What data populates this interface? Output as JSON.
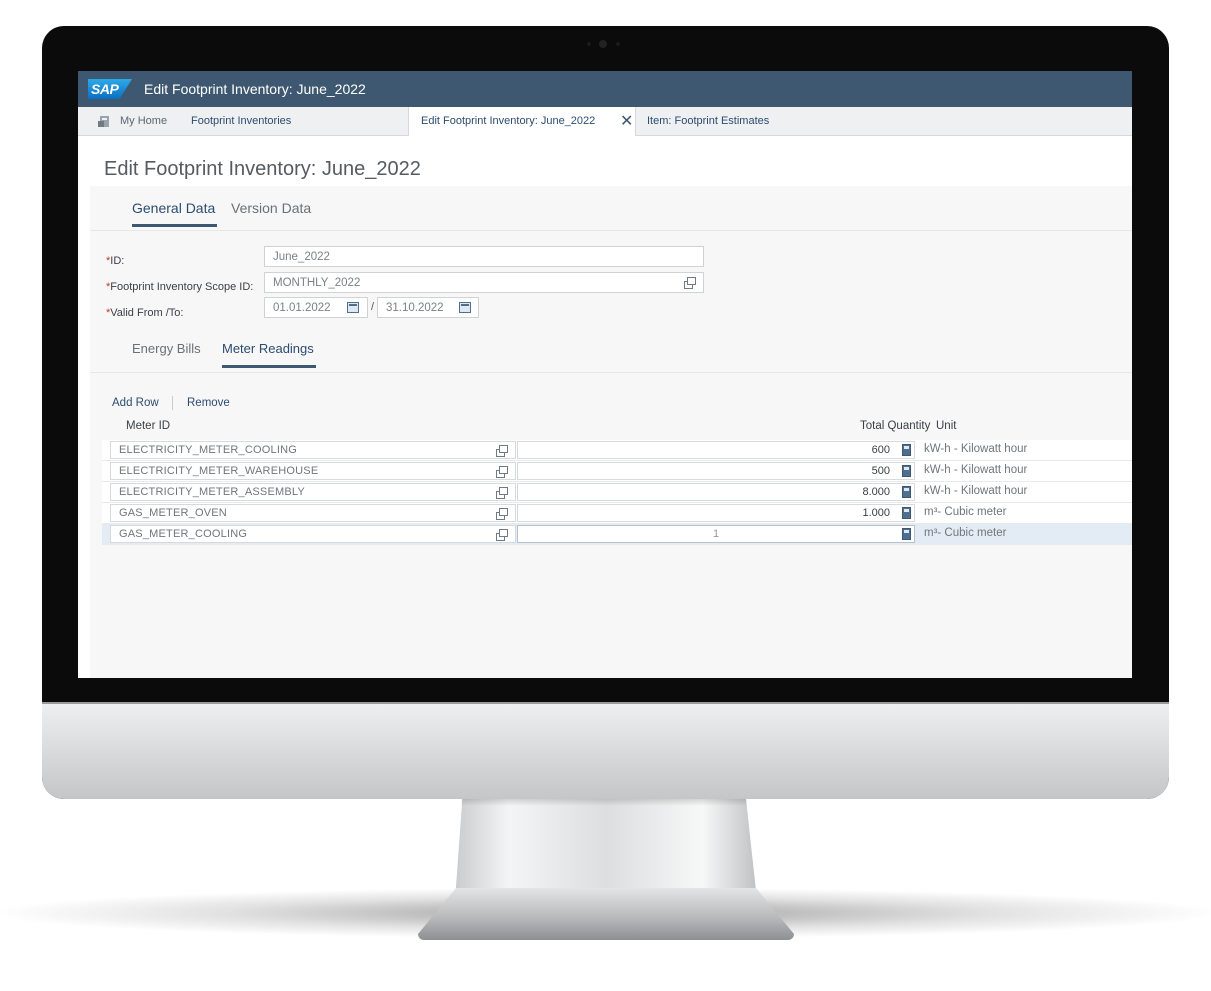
{
  "shell": {
    "logo": "SAP",
    "title": "Edit Footprint Inventory: June_2022"
  },
  "tabs": {
    "home": "My Home",
    "crumb": "Footprint Inventories",
    "active": "Edit Footprint Inventory: June_2022",
    "item": "Item: Footprint Estimates"
  },
  "page": {
    "title": "Edit Footprint Inventory: June_2022",
    "object_tabs": [
      "General Data",
      "Version Data"
    ],
    "active_object_tab": "General Data"
  },
  "form": {
    "required_mark": "*",
    "id_label": "ID:",
    "id_value": "June_2022",
    "scope_label": "Footprint Inventory Scope ID:",
    "scope_value": "MONTHLY_2022",
    "valid_label": "Valid From /To:",
    "valid_from": "01.01.2022",
    "valid_to": "31.10.2022",
    "date_separator": "/"
  },
  "subtabs": {
    "items": [
      "Energy Bills",
      "Meter Readings"
    ],
    "active": "Meter Readings"
  },
  "toolbar": {
    "add_row": "Add Row",
    "remove": "Remove"
  },
  "table": {
    "headers": {
      "meter_id": "Meter ID",
      "total_quantity": "Total Quantity",
      "unit": "Unit"
    },
    "rows": [
      {
        "meter_id": "ELECTRICITY_METER_COOLING",
        "quantity": "600",
        "unit": "kW-h - Kilowatt hour"
      },
      {
        "meter_id": "ELECTRICITY_METER_WAREHOUSE",
        "quantity": "500",
        "unit": "kW-h - Kilowatt hour"
      },
      {
        "meter_id": "ELECTRICITY_METER_ASSEMBLY",
        "quantity": "8.000",
        "unit": "kW-h - Kilowatt hour"
      },
      {
        "meter_id": "GAS_METER_OVEN",
        "quantity": "1.000",
        "unit": "m³- Cubic meter"
      },
      {
        "meter_id": "GAS_METER_COOLING",
        "quantity": "1",
        "unit": "m³- Cubic meter"
      }
    ],
    "selected_row": 4
  },
  "colors": {
    "shell": "#3d5870",
    "link": "#2b4c6f",
    "required": "#c0392b",
    "selected_row": "#e3ecf5"
  },
  "icons": [
    "home-icon",
    "close-icon",
    "value-help-icon",
    "calendar-icon",
    "calculator-icon"
  ]
}
